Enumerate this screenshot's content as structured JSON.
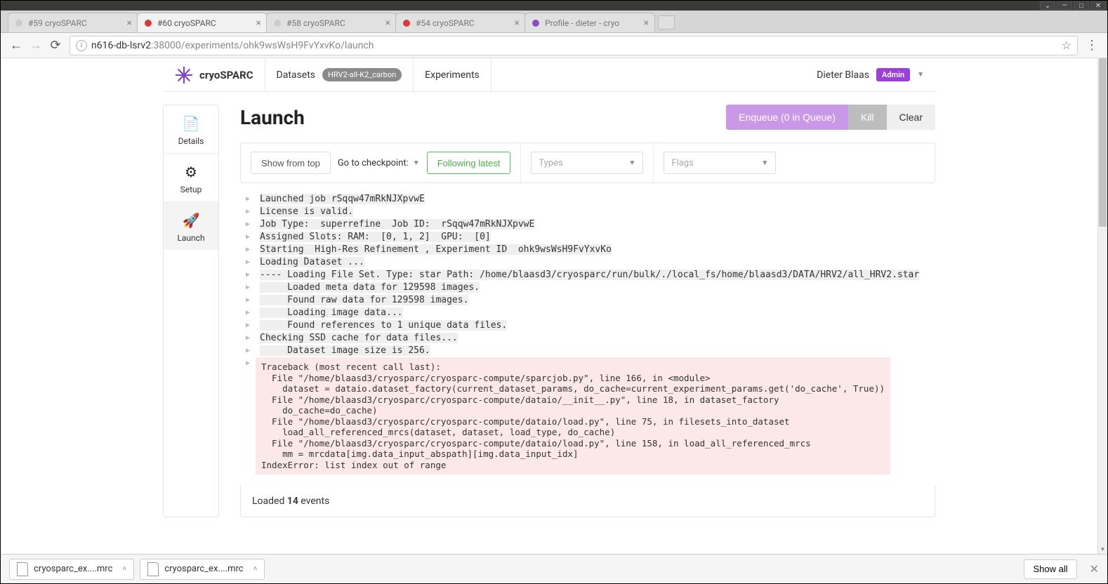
{
  "tabs": [
    {
      "title": "#59 cryoSPARC",
      "active": false,
      "favColor": "#ccc"
    },
    {
      "title": "#60 cryoSPARC",
      "active": true,
      "favColor": "#d93a3a"
    },
    {
      "title": "#58 cryoSPARC",
      "active": false,
      "favColor": "#ccc"
    },
    {
      "title": "#54 cryoSPARC",
      "active": false,
      "favColor": "#d93a3a"
    },
    {
      "title": "Profile - dieter - cryo",
      "active": false,
      "favColor": "#8a4bc4"
    }
  ],
  "url": {
    "host": "n616-db-lsrv2",
    "rest": ":38000/experiments/ohk9wsWsH9FvYxvKo/launch"
  },
  "header": {
    "brand": "cryoSPARC",
    "nav_datasets": "Datasets",
    "dataset_badge": "HRV2-all-K2_carbon",
    "nav_experiments": "Experiments",
    "user_name": "Dieter Blaas",
    "admin_badge": "Admin"
  },
  "sidebar": {
    "details": "Details",
    "setup": "Setup",
    "launch": "Launch"
  },
  "page": {
    "title": "Launch",
    "btn_enqueue": "Enqueue (0 in Queue)",
    "btn_kill": "Kill",
    "btn_clear": "Clear"
  },
  "toolbar": {
    "show_from_top": "Show from top",
    "goto_checkpoint": "Go to checkpoint:",
    "following_latest": "Following latest",
    "types_placeholder": "Types",
    "flags_placeholder": "Flags"
  },
  "log": {
    "lines": [
      {
        "t": "Launched job rSqqw47mRkNJXpvwE",
        "hl": true
      },
      {
        "t": "License is valid.",
        "hl": true
      },
      {
        "t": "Job Type:  superrefine  Job ID:  rSqqw47mRkNJXpvwE",
        "hl": true
      },
      {
        "t": "Assigned Slots: RAM:  [0, 1, 2]  GPU:  [0]",
        "hl": true
      },
      {
        "t": "Starting  High-Res Refinement , Experiment ID  ohk9wsWsH9FvYxvKo",
        "hl": true
      },
      {
        "t": "Loading Dataset ...",
        "hl": true
      },
      {
        "t": "---- Loading File Set. Type: star Path: /home/blaasd3/cryosparc/run/bulk/./local_fs/home/blaasd3/DATA/HRV2/all_HRV2.star",
        "hl": true
      },
      {
        "t": "     Loaded meta data for 129598 images.",
        "hl": true
      },
      {
        "t": "     Found raw data for 129598 images.",
        "hl": true
      },
      {
        "t": "     Loading image data...",
        "hl": true
      },
      {
        "t": "     Found references to 1 unique data files.",
        "hl": true
      },
      {
        "t": "Checking SSD cache for data files...",
        "hl": true
      },
      {
        "t": "     Dataset image size is 256.",
        "hl": true
      }
    ],
    "traceback_header": "Traceback (most recent call last):",
    "traceback_body": "  File \"/home/blaasd3/cryosparc/cryosparc-compute/sparcjob.py\", line 166, in <module>\n    dataset = dataio.dataset_factory(current_dataset_params, do_cache=current_experiment_params.get('do_cache', True))\n  File \"/home/blaasd3/cryosparc/cryosparc-compute/dataio/__init__.py\", line 18, in dataset_factory\n    do_cache=do_cache)\n  File \"/home/blaasd3/cryosparc/cryosparc-compute/dataio/load.py\", line 75, in filesets_into_dataset\n    load_all_referenced_mrcs(dataset, dataset, load_type, do_cache)\n  File \"/home/blaasd3/cryosparc/cryosparc-compute/dataio/load.py\", line 158, in load_all_referenced_mrcs\n    mm = mrcdata[img.data_input_abspath][img.data_input_idx]\nIndexError: list index out of range"
  },
  "footer": {
    "loaded_prefix": "Loaded ",
    "loaded_count": "14",
    "loaded_suffix": " events"
  },
  "downloads": {
    "item1": "cryosparc_ex....mrc",
    "item2": "cryosparc_ex....mrc",
    "show_all": "Show all"
  }
}
